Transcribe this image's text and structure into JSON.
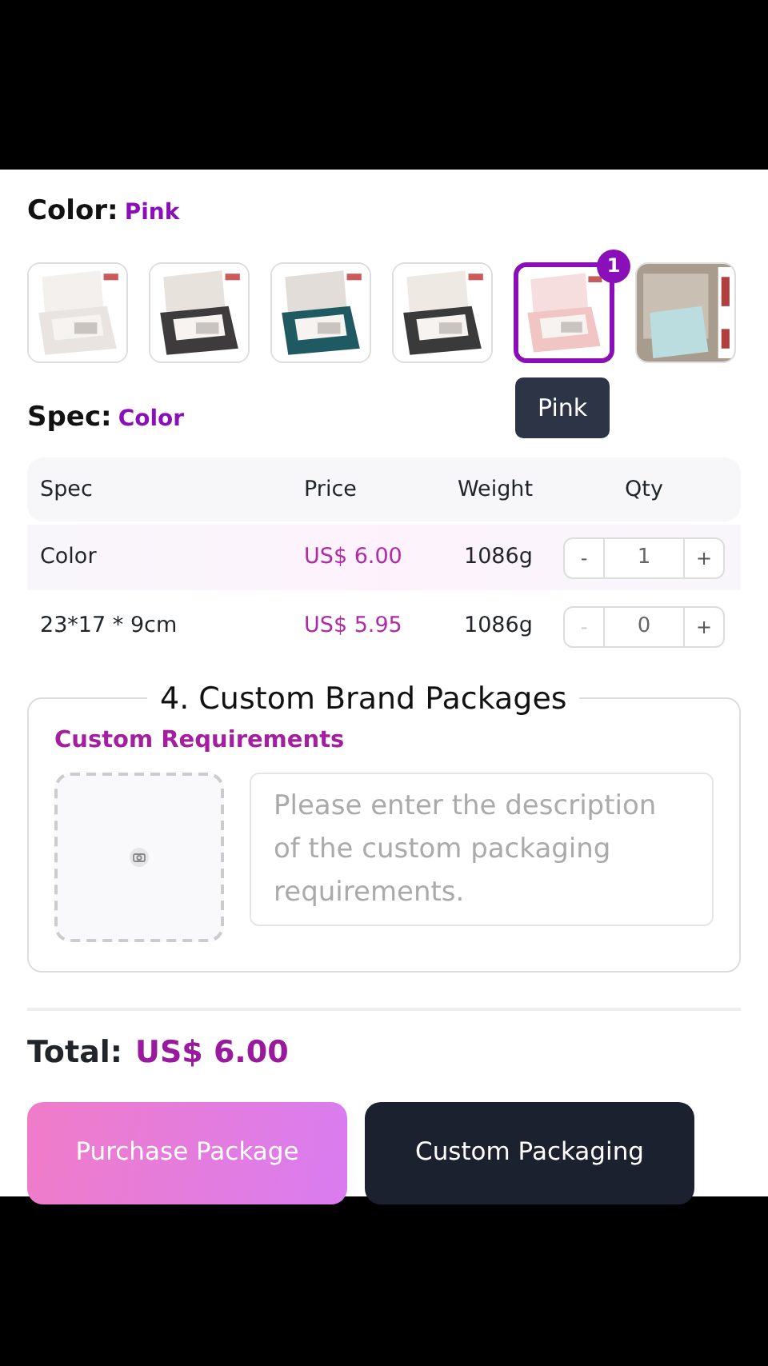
{
  "color": {
    "label": "Color:",
    "value": "Pink"
  },
  "thumbnails": [
    {
      "kind": "picture",
      "selected": false
    },
    {
      "kind": "picture",
      "selected": false
    },
    {
      "kind": "picture",
      "selected": false
    },
    {
      "kind": "picture",
      "selected": false
    },
    {
      "kind": "picture",
      "selected": true,
      "badge": "1",
      "tooltip": "Pink"
    },
    {
      "kind": "picture",
      "selected": false
    }
  ],
  "spec": {
    "label": "Spec:",
    "value": "Color"
  },
  "table": {
    "columns": [
      "Spec",
      "Price",
      "Weight",
      "Qty"
    ],
    "rows": [
      {
        "spec": "Color",
        "price": "US$ 6.00",
        "weight": "1086g",
        "qty": "1",
        "minus": "-",
        "plus": "+",
        "minus_disabled": false,
        "selected": true
      },
      {
        "spec": "23*17 * 9cm",
        "price": "US$ 5.95",
        "weight": "1086g",
        "qty": "0",
        "minus": "-",
        "plus": "+",
        "minus_disabled": true,
        "selected": false
      }
    ]
  },
  "custom": {
    "legend": "4. Custom Brand Packages",
    "title": "Custom Requirements",
    "placeholder": "Please enter the description of the custom packaging requirements."
  },
  "total": {
    "label": "Total:",
    "value": "US$ 6.00"
  },
  "buttons": [
    {
      "kind": "primary",
      "label": "Purchase Package"
    },
    {
      "kind": "dark",
      "label": "Custom Packaging"
    }
  ]
}
